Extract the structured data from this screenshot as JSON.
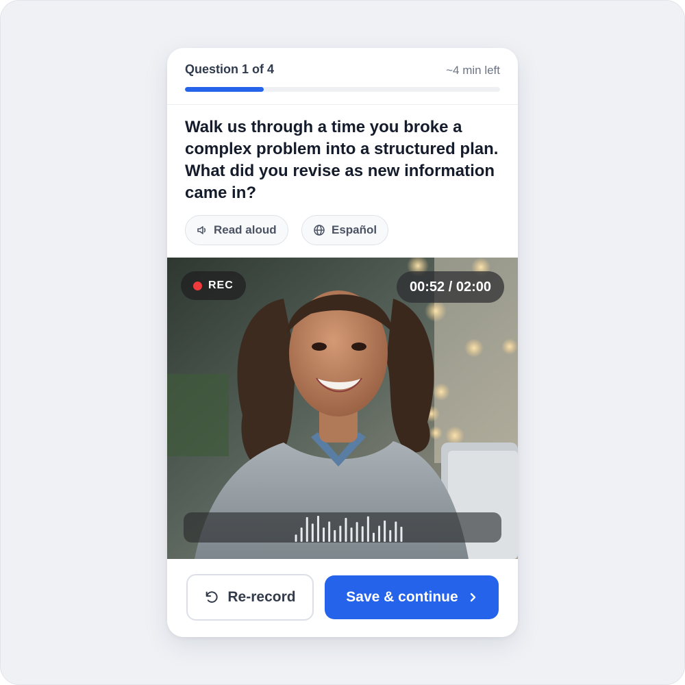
{
  "colors": {
    "accent": "#2563eb",
    "rec": "#ef3b3b",
    "page_bg": "#eff1f5"
  },
  "header": {
    "question_counter": "Question 1 of 4",
    "time_left": "~4 min left",
    "progress": 0.25
  },
  "question": {
    "text": "Walk us through a time you broke a complex problem into a structured plan. What did you revise as new information came in?"
  },
  "actions": {
    "read_aloud": {
      "label": "Read aloud",
      "icon": "speaker-icon"
    },
    "language": {
      "label": "Español",
      "icon": "globe-icon"
    }
  },
  "video": {
    "rec_label": "REC",
    "timer": "00:52 / 02:00",
    "waveform_levels": [
      0.28,
      0.55,
      0.95,
      0.7,
      1.0,
      0.55,
      0.78,
      0.45,
      0.62,
      0.92,
      0.55,
      0.76,
      0.6,
      0.98,
      0.35,
      0.62,
      0.82,
      0.45,
      0.78,
      0.58
    ]
  },
  "footer": {
    "rerecord_label": "Re-record",
    "rerecord_icon": "rotate-ccw-icon",
    "save_label": "Save & continue",
    "save_icon": "chevron-right-icon"
  }
}
